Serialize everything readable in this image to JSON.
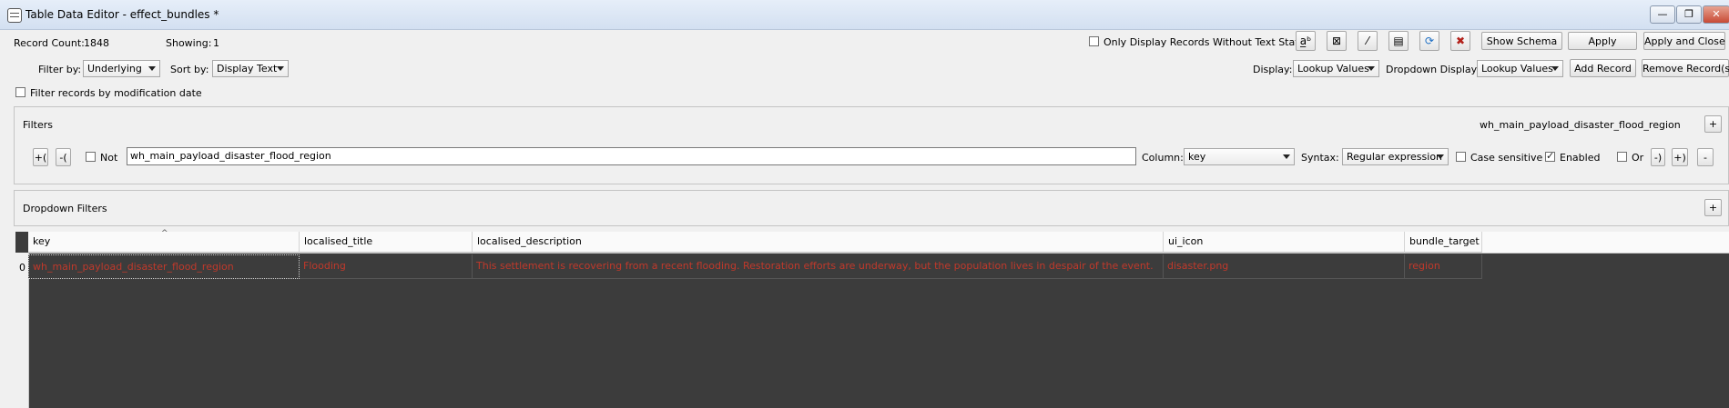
{
  "window": {
    "title": "Table Data Editor - effect_bundles *",
    "minimize_glyph": "—",
    "maximize_glyph": "❐",
    "close_glyph": "✕"
  },
  "stats": {
    "record_count_label": "Record Count:",
    "record_count": "1848",
    "showing_label": "Showing:",
    "showing": "1"
  },
  "filter_by": {
    "label": "Filter by:",
    "value": "Underlying"
  },
  "sort_by": {
    "label": "Sort by:",
    "value": "Display Text"
  },
  "only_display_without_text_state": {
    "label": "Only Display Records Without Text State",
    "checked": false
  },
  "toolbar_icons": [
    {
      "name": "text-state-icon",
      "glyph": "a̲ᵇ"
    },
    {
      "name": "clear-box-icon",
      "glyph": "⊠"
    },
    {
      "name": "edit-slash-icon",
      "glyph": "⁄"
    },
    {
      "name": "document-icon",
      "glyph": "▤"
    },
    {
      "name": "refresh-icon",
      "glyph": "⟳"
    },
    {
      "name": "delete-x-icon",
      "glyph": "✖"
    }
  ],
  "buttons": {
    "show_schema": "Show Schema",
    "apply": "Apply",
    "apply_and_close": "Apply and Close",
    "add_record": "Add Record",
    "remove_records": "Remove Record(s)"
  },
  "display": {
    "label": "Display:",
    "value": "Lookup Values"
  },
  "dropdown_display": {
    "label": "Dropdown Display:",
    "value": "Lookup Values"
  },
  "filter_by_mod_date": {
    "label": "Filter records by modification date",
    "checked": false
  },
  "filters_panel": {
    "title": "Filters",
    "summary": "wh_main_payload_disaster_flood_region",
    "add_glyph": "+",
    "open_paren_btn": "+(",
    "close_paren_btn": "-(",
    "not_label": "Not",
    "not_checked": false,
    "filter_text": "wh_main_payload_disaster_flood_region",
    "column_label": "Column:",
    "column_value": "key",
    "syntax_label": "Syntax:",
    "syntax_value": "Regular expression",
    "case_sensitive_label": "Case sensitive",
    "case_sensitive_checked": false,
    "enabled_label": "Enabled",
    "enabled_checked": true,
    "or_label": "Or",
    "or_checked": false,
    "remove_paren_btn": "-)",
    "add_paren_btn": "+)",
    "remove_btn": "-"
  },
  "dropdown_filters": {
    "title": "Dropdown Filters",
    "add_glyph": "+"
  },
  "table": {
    "sort_indicator": "^",
    "columns": [
      "key",
      "localised_title",
      "localised_description",
      "ui_icon",
      "bundle_target"
    ],
    "rows": [
      {
        "index": "0",
        "cells": [
          "wh_main_payload_disaster_flood_region",
          "Flooding",
          "This settlement is recovering from a recent flooding. Restoration efforts are underway, but the population lives in despair of the event.",
          "disaster.png",
          "region"
        ]
      }
    ],
    "cell_text_color": "#c0392b",
    "body_background": "#3c3c3c"
  }
}
